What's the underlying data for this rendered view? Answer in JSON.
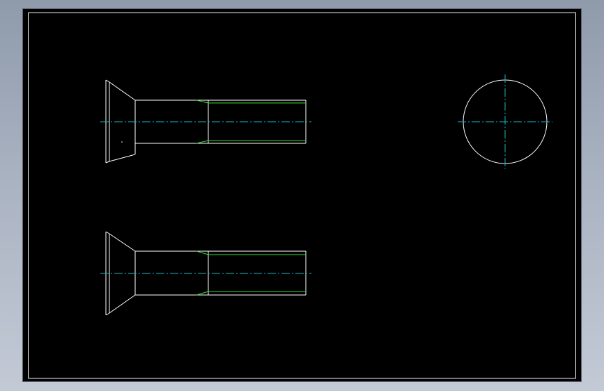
{
  "colors": {
    "background": "#000000",
    "outline": "#ffffff",
    "thread": "#33dd33",
    "centerline": "#19b8c8",
    "frame": "#ffffff"
  },
  "views": {
    "top_bolt": "countersunk-screw-side-view-with-hidden-head-edge",
    "bottom_bolt": "countersunk-screw-side-view",
    "end_view": "screw-end-view-circle"
  }
}
